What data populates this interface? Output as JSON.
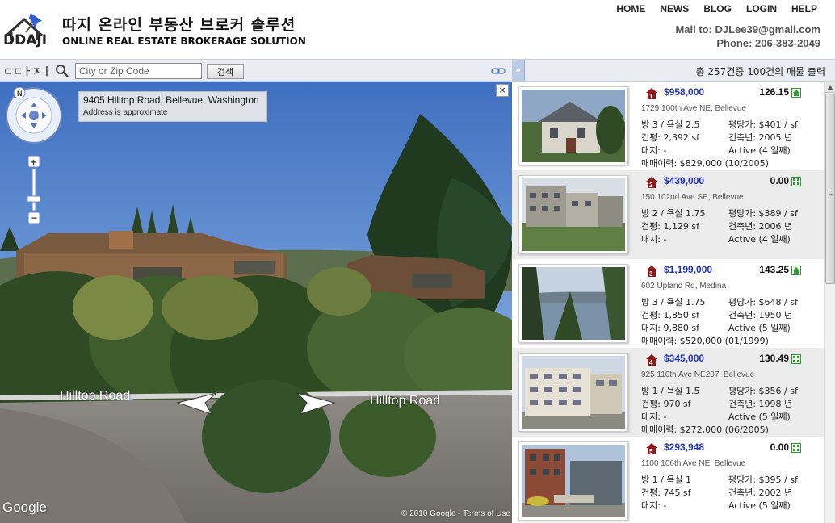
{
  "header": {
    "ko_title": "따지 온라인 부동산 브로커 솔루션",
    "en_title": "ONLINE REAL ESTATE BROKERAGE SOLUTION",
    "logo_word": "DDAJI",
    "nav": [
      "HOME",
      "NEWS",
      "BLOG",
      "LOGIN",
      "HELP"
    ],
    "mail": "Mail to: DJLee39@gmail.com",
    "phone": "Phone: 206-383-2049"
  },
  "search": {
    "brand": "ㄷㄷㅏㅈㅣ",
    "placeholder": "City or Zip Code",
    "button_label": "검색"
  },
  "list_header": {
    "collapse_label": "»",
    "count_text": "총 257건중 100건의 매물 출력"
  },
  "streetview": {
    "address": "9405 Hilltop Road, Bellevue, Washington",
    "address_note": "Address is approximate",
    "close_label": "×",
    "road_left": "Hilltop Road",
    "road_right": "Hilltop Road",
    "google": "Google",
    "copyright": "© 2010 Google - ",
    "terms": "Terms of Use"
  },
  "listings": [
    {
      "num": "1",
      "price": "$958,000",
      "score": "126.15",
      "score_type": "house",
      "address": "1729 100th Ave NE, Bellevue",
      "rooms": "방 3 / 욕실 2.5",
      "ppsf": "평당가: $401 / sf",
      "area": "건평: 2,392 sf",
      "built": "건축년: 2005 년",
      "lot": "대지: -",
      "status": "Active (4 일째)",
      "sold": "매매이력: $829,000 (10/2005)"
    },
    {
      "num": "2",
      "price": "$439,000",
      "score": "0.00",
      "score_type": "condo",
      "address": "150 102nd Ave SE, Bellevue",
      "rooms": "방 2 / 욕실 1.75",
      "ppsf": "평당가: $389 / sf",
      "area": "건평: 1,129 sf",
      "built": "건축년: 2006 년",
      "lot": "대지: -",
      "status": "Active (4 일째)",
      "sold": ""
    },
    {
      "num": "3",
      "price": "$1,199,000",
      "score": "143.25",
      "score_type": "house",
      "address": "602 Upland Rd, Medina",
      "rooms": "방 3 / 욕실 1.75",
      "ppsf": "평당가: $648 / sf",
      "area": "건평: 1,850 sf",
      "built": "건축년: 1950 년",
      "lot": "대지: 9,880 sf",
      "status": "Active (5 일째)",
      "sold": "매매이력: $520,000 (01/1999)"
    },
    {
      "num": "4",
      "price": "$345,000",
      "score": "130.49",
      "score_type": "condo",
      "address": "925 110th Ave NE207, Bellevue",
      "rooms": "방 1 / 욕실 1.5",
      "ppsf": "평당가: $356 / sf",
      "area": "건평: 970 sf",
      "built": "건축년: 1998 년",
      "lot": "대지: -",
      "status": "Active (5 일째)",
      "sold": "매매이력: $272,000 (06/2005)"
    },
    {
      "num": "5",
      "price": "$293,948",
      "score": "0.00",
      "score_type": "condo",
      "address": "1100 106th Ave NE, Bellevue",
      "rooms": "방 1 / 욕실 1",
      "ppsf": "평당가: $395 / sf",
      "area": "건평: 745 sf",
      "built": "건축년: 2002 년",
      "lot": "대지: -",
      "status": "Active (5 일째)",
      "sold": ""
    }
  ],
  "colors": {
    "price": "#2233bb",
    "pin": "#8b1a1a",
    "score_icon": "#2a9d2a"
  }
}
